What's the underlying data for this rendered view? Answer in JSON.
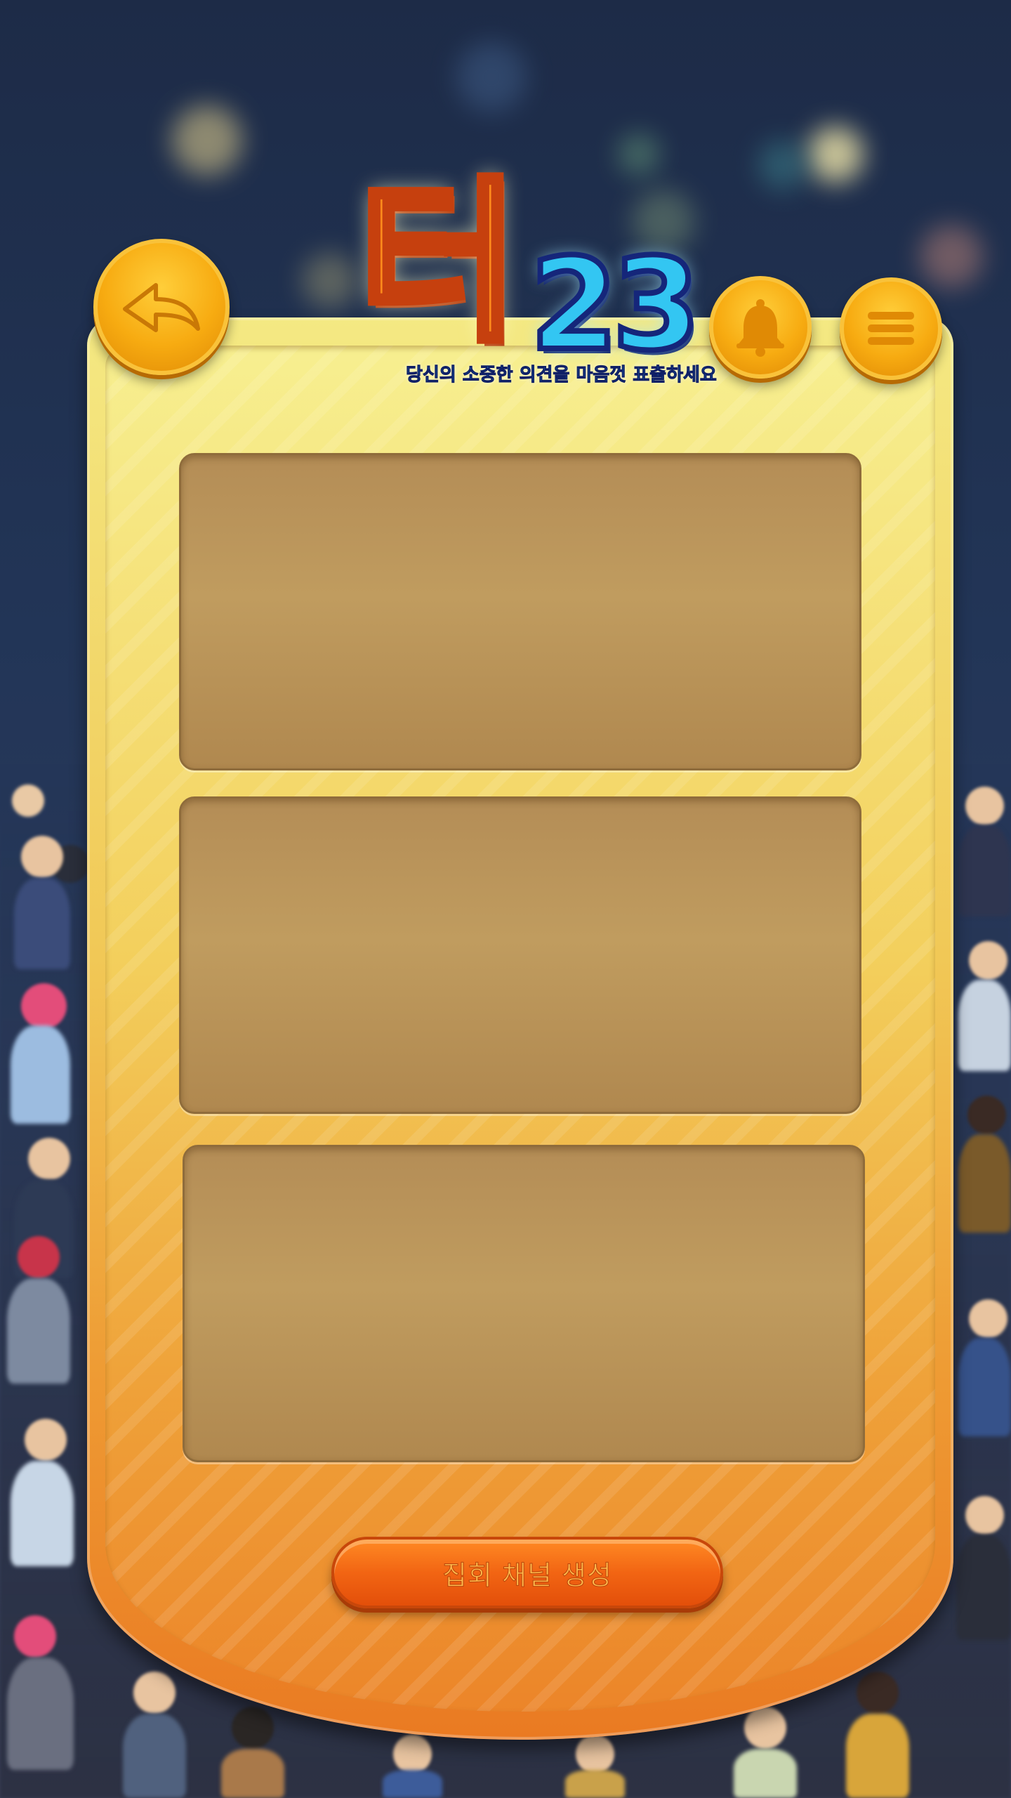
{
  "header": {
    "logo": {
      "title_han": "터",
      "title_num": "23",
      "tagline": "당신의 소중한 의견을 마음껏 표출하세요"
    },
    "back_icon": "back-arrow-icon",
    "bell_icon": "bell-icon",
    "menu_icon": "menu-icon"
  },
  "panels": [
    {
      "id": "slot-1"
    },
    {
      "id": "slot-2"
    },
    {
      "id": "slot-3"
    }
  ],
  "footer": {
    "create_button_label": "집회 채널 생성"
  },
  "colors": {
    "button_orange": "#f7ab11",
    "board_top": "#f4e983",
    "board_bottom": "#ea7a22",
    "panel": "#b48d56",
    "logo_orange": "#ff8a1c",
    "logo_blue": "#33c6f2"
  }
}
